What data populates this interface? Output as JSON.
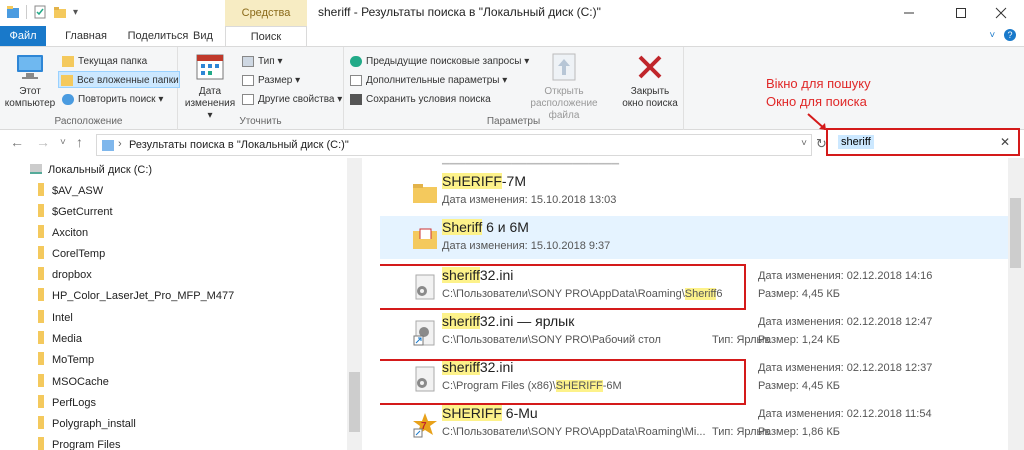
{
  "window": {
    "title": "sheriff - Результаты поиска в \"Локальный диск (C:)\"",
    "context_tab": "Средства поиска"
  },
  "tabs": [
    "Файл",
    "Главная",
    "Поделиться",
    "Вид",
    "Поиск"
  ],
  "ribbon": {
    "location": {
      "this_pc": "Этот\nкомпьютер",
      "current_folder": "Текущая папка",
      "all_subfolders": "Все вложенные папки",
      "search_again": "Повторить поиск",
      "label": "Расположение"
    },
    "refine": {
      "date_modified": "Дата\nизменения",
      "kind": "Тип",
      "size": "Размер",
      "other_properties": "Другие свойства",
      "label": "Уточнить"
    },
    "options": {
      "recent_searches": "Предыдущие поисковые запросы",
      "advanced": "Дополнительные параметры",
      "save_search": "Сохранить условия поиска",
      "open_location": "Открыть\nрасположение файла",
      "close_search": "Закрыть\nокно поиска",
      "label": "Параметры"
    }
  },
  "address": {
    "path": "Результаты поиска в \"Локальный диск (C:)\""
  },
  "search": {
    "value": "sheriff"
  },
  "annotation": {
    "line1": "Вікно для пошуку",
    "line2": "Окно для поиска"
  },
  "nav": {
    "drive": "Локальный диск (C:)",
    "folders": [
      "$AV_ASW",
      "$GetCurrent",
      "Axciton",
      "CorelTemp",
      "dropbox",
      "HP_Color_LaserJet_Pro_MFP_M477",
      "Intel",
      "Media",
      "MoTemp",
      "MSOCache",
      "PerfLogs",
      "Polygraph_install",
      "Program Files"
    ]
  },
  "results": [
    {
      "name_hl": "SHERIFF",
      "name_rest": "-7M",
      "sub": "Дата изменения: 15.10.2018 13:03",
      "icon": "folder-icon"
    },
    {
      "name_hl": "Sheriff",
      "name_rest": " 6 и 6М",
      "sub": "Дата изменения: 15.10.2018 9:37",
      "icon": "folder-pdf-icon"
    },
    {
      "name_hl": "sheriff",
      "name_rest": "32.ini",
      "path_pre": "C:\\Пользователи\\SONY PRO\\AppData\\Roaming\\",
      "path_hl": "Sheriff",
      "path_post": "6",
      "date": "Дата изменения: 02.12.2018 14:16",
      "size": "Размер: 4,45 КБ",
      "icon": "settings-file-icon"
    },
    {
      "name_hl": "sheriff",
      "name_rest": "32.ini — ярлык",
      "path_pre": "C:\\Пользователи\\SONY PRO\\Рабочий стол",
      "path_hl": "",
      "path_post": "",
      "type": "Тип: Ярлык",
      "date": "Дата изменения: 02.12.2018 12:47",
      "size": "Размер: 1,24 КБ",
      "icon": "shortcut-file-icon"
    },
    {
      "name_hl": "sheriff",
      "name_rest": "32.ini",
      "path_pre": "C:\\Program Files (x86)\\",
      "path_hl": "SHERIFF",
      "path_post": "-6M",
      "date": "Дата изменения: 02.12.2018 12:37",
      "size": "Размер: 4,45 КБ",
      "icon": "settings-file-icon"
    },
    {
      "name_hl": "SHERIFF",
      "name_rest": " 6-Mu",
      "path_pre": "C:\\Пользователи\\SONY PRO\\AppData\\Roaming\\Mi...",
      "path_hl": "",
      "path_post": "",
      "type": "Тип: Ярлык",
      "date": "Дата изменения: 02.12.2018 11:54",
      "size": "Размер: 1,86 КБ",
      "icon": "app-shortcut-icon"
    }
  ],
  "colors": {
    "accent": "#1979ca",
    "highlight": "#fdf28a",
    "annotation_red": "#d41a1a"
  }
}
